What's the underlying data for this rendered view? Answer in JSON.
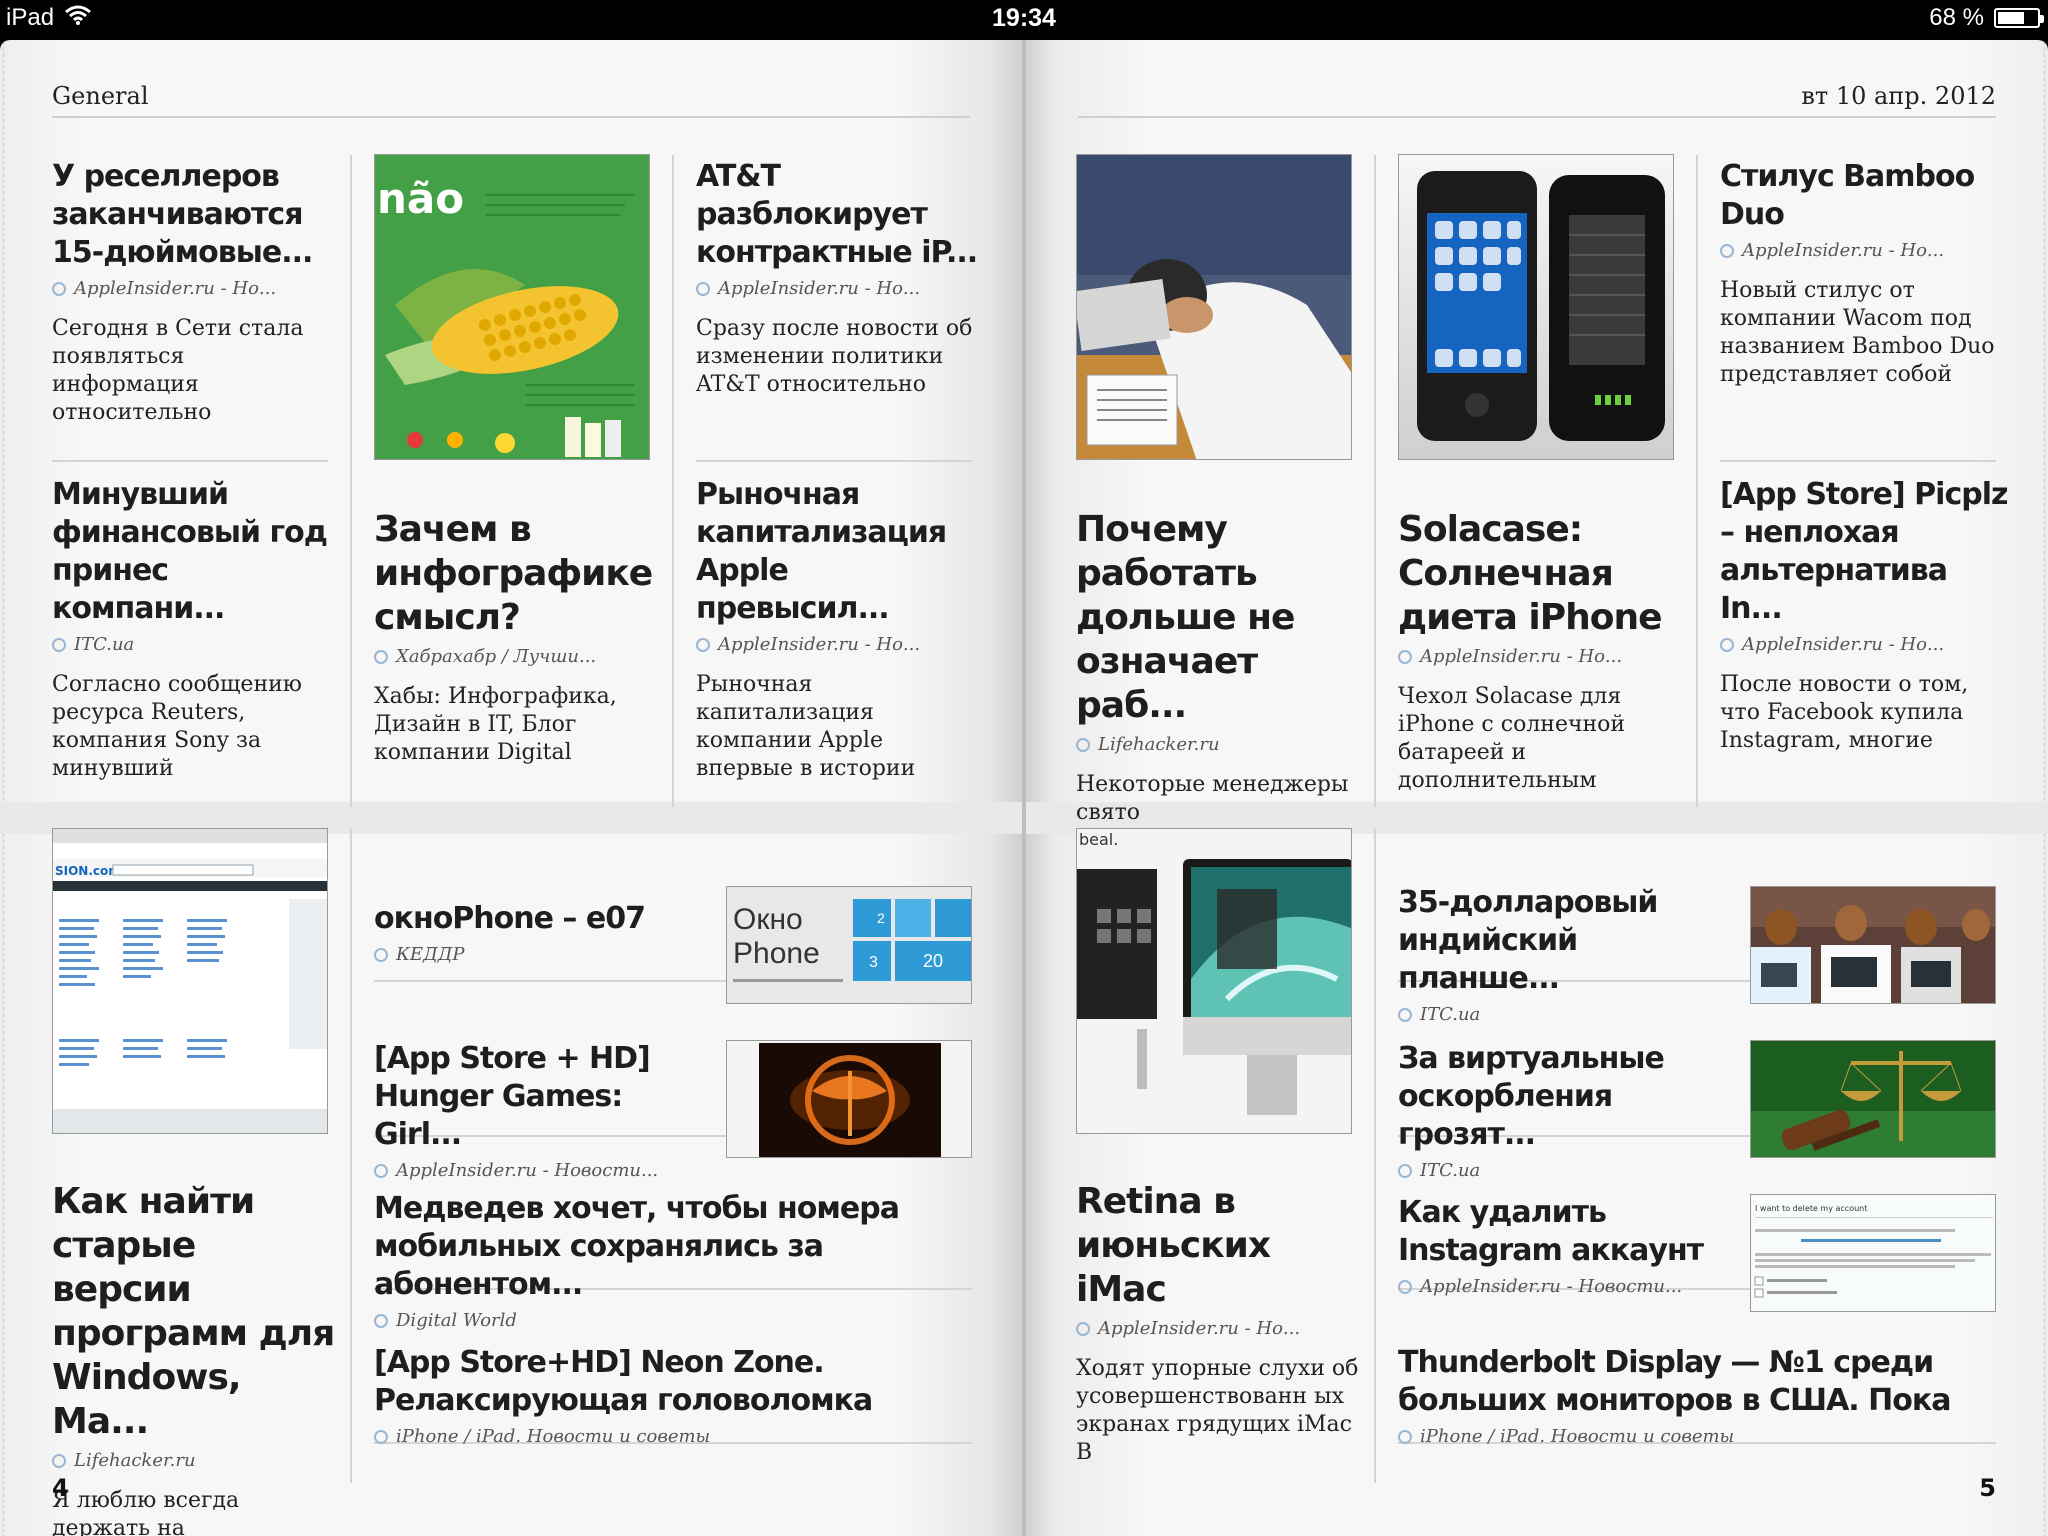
{
  "status_bar": {
    "device": "iPad",
    "time": "19:34",
    "battery": "68 %",
    "battery_level": 0.68
  },
  "left_page": {
    "section": "General",
    "page_number": "4",
    "articles": [
      {
        "title": "У реселлеров заканчиваются 15-дюймовые...",
        "source": "AppleInsider.ru - Но...",
        "snippet": "Сегодня в Сети стала появляться информация относительно"
      },
      {
        "title": "Минувший финансовый год принес компани...",
        "source": "ITC.ua",
        "snippet": "Согласно сообщению ресурса Reuters, компания Sony за минувший"
      },
      {
        "title": "Зачем в инфографике смысл?",
        "source": "Хабрахабр / Лучши...",
        "snippet": "Хабы: Инфографика, Дизайн в IT, Блог компании Digital"
      },
      {
        "title": "AT&T разблокирует контрактные iP...",
        "source": "AppleInsider.ru - Но...",
        "snippet": "Сразу после новости об изменении политики AT&T относительно"
      },
      {
        "title": "Рыночная капитализация Apple превысил...",
        "source": "AppleInsider.ru - Но...",
        "snippet": "Рыночная капитализация компании Apple впервые в истории"
      },
      {
        "title": "Как найти старые версии программ для Windows, Ma...",
        "source": "Lifehacker.ru",
        "snippet": "Я люблю всегда держать на"
      },
      {
        "title": "окноPhone – e07",
        "source": "КЕДДР"
      },
      {
        "title": "[App Store + HD] Hunger Games: Girl...",
        "source": "AppleInsider.ru - Новости..."
      },
      {
        "title": "Медведев хочет, чтобы номера мобильных сохранялись за абонентом...",
        "source": "Digital World"
      },
      {
        "title": "[App Store+HD] Neon Zone. Релаксирующая головоломка",
        "source": "iPhone / iPad. Новости и советы"
      }
    ],
    "thumb_text": {
      "okno_line1": "Окно",
      "okno_line2": "Phone",
      "okno_count1": "2",
      "okno_count2": "3",
      "okno_count3": "20",
      "corn_label": "não",
      "browser_logo": "SION.com"
    }
  },
  "right_page": {
    "date": "вт 10 апр. 2012",
    "page_number": "5",
    "articles": [
      {
        "title": "Почему работать дольше не означает раб...",
        "source": "Lifehacker.ru",
        "snippet": "Некоторые менеджеры свято"
      },
      {
        "title": "Solacase: Солнечная диета iPhone",
        "source": "AppleInsider.ru - Но...",
        "snippet": "Чехол Solacase для iPhone с солнечной батареей и дополнительным"
      },
      {
        "title": "Стилус Bamboo Duo",
        "source": "AppleInsider.ru - Но...",
        "snippet": "Новый стилус от компании Wacom под названием Bamboo Duo представляет собой"
      },
      {
        "title": "[App Store] Picplz – неплохая альтернатива In...",
        "source": "AppleInsider.ru - Но...",
        "snippet": "После новости о том, что Facebook купила Instagram, многие"
      },
      {
        "title": "Retina в июньских iMac",
        "source": "AppleInsider.ru - Но...",
        "snippet": "Ходят упорные слухи об усовершенствованн ых экранах грядущих iMac  В"
      },
      {
        "title": "35-долларовый индийский планше...",
        "source": "ITC.ua"
      },
      {
        "title": "За виртуальные оскорбления грозят...",
        "source": "ITC.ua"
      },
      {
        "title": "Как удалить Instagram аккаунт",
        "source": "AppleInsider.ru - Новости..."
      },
      {
        "title": "Thunderbolt Display — №1 среди больших мониторов в США. Пока",
        "source": "iPhone / iPad. Новости и советы"
      }
    ],
    "thumb_text": {
      "imac_label": "beal.",
      "instagram_heading": "I want to delete my account"
    }
  },
  "colors": {
    "page": "#f7f7f7",
    "source_dot": "#9ab6d0",
    "okno_blue": "#2e9ad6"
  }
}
